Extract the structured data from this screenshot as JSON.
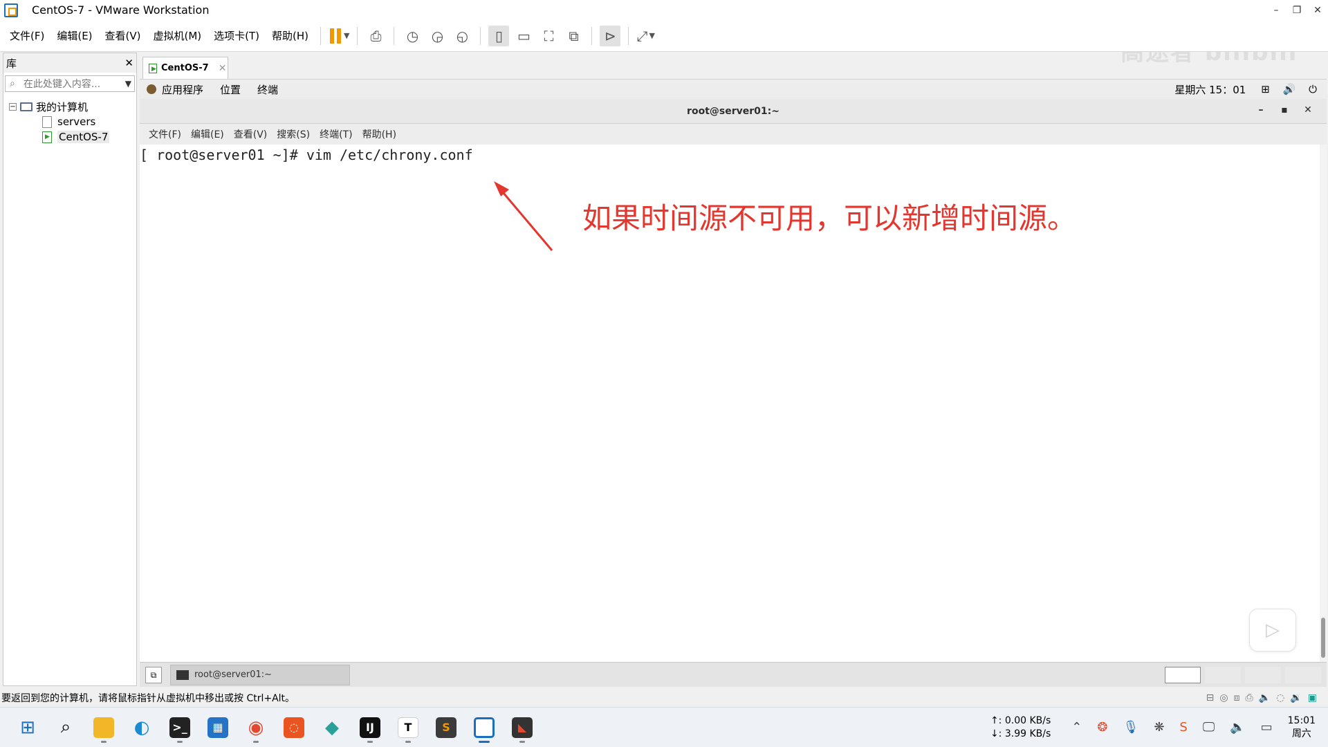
{
  "window": {
    "title": "CentOS-7 - VMware Workstation",
    "controls": [
      "–",
      "❐",
      "✕"
    ]
  },
  "menu": [
    "文件(F)",
    "编辑(E)",
    "查看(V)",
    "虚拟机(M)",
    "选项卡(T)",
    "帮助(H)"
  ],
  "library": {
    "title": "库",
    "close": "✕",
    "search_placeholder": "在此处键入内容...",
    "root": "我的计算机",
    "items": [
      "servers",
      "CentOS-7"
    ],
    "selected": "CentOS-7"
  },
  "tab": {
    "label": "CentOS-7",
    "close": "✕"
  },
  "guest_topbar": {
    "menus": [
      "应用程序",
      "位置",
      "终端"
    ],
    "clock": "星期六 15：01"
  },
  "terminal": {
    "title": "root@server01:~",
    "controls": [
      "–",
      "▪",
      "✕"
    ],
    "menus": [
      "文件(F)",
      "编辑(E)",
      "查看(V)",
      "搜索(S)",
      "终端(T)",
      "帮助(H)"
    ],
    "line": "[ root@server01 ~]# vim /etc/chrony.conf"
  },
  "annotation": {
    "text": "如果时间源不可用，可以新增时间源。",
    "color": "#e3362e"
  },
  "guest_taskbar": {
    "item": "root@server01:~"
  },
  "statusbar": {
    "text": "要返回到您的计算机，请将鼠标指针从虚拟机中移出或按 Ctrl+Alt。"
  },
  "taskbar": {
    "net_up": "↑: 0.00 KB/s",
    "net_down": "↓: 3.99 KB/s",
    "time": "15:01",
    "day": "周六"
  },
  "colors": {
    "accent": "#1b6fbf",
    "vm_orange": "#f29900"
  }
}
